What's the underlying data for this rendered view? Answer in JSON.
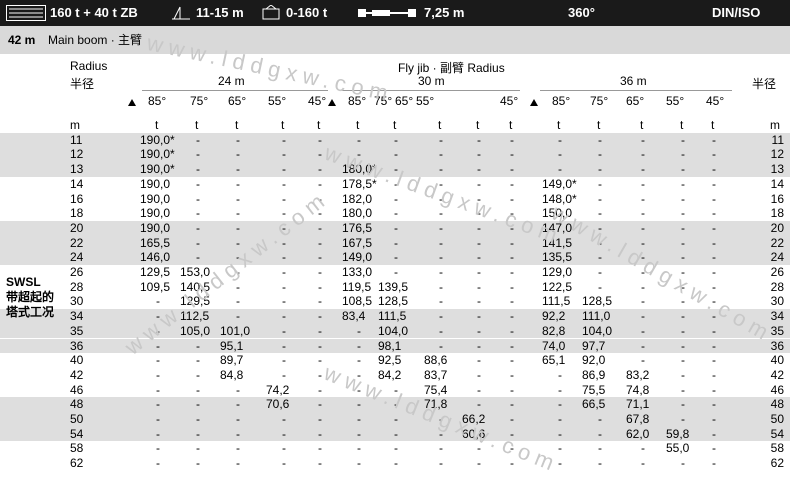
{
  "topbar": {
    "capacity": "160 t + 40 t ZB",
    "counterweight_range": "11-15 m",
    "load_range": "0-160 t",
    "width": "7,25 m",
    "slew": "360°",
    "standard": "DIN/ISO"
  },
  "subbar": {
    "boom_length": "42 m",
    "boom_label": "Main boom · 主臂"
  },
  "header": {
    "radius_label": "Radius",
    "radius_cn": "半径",
    "radius_cn_right": "半径",
    "fly_jib_label": "Fly jib · 副臂 Radius",
    "jib_lengths": [
      "24 m",
      "30 m",
      "36 m"
    ],
    "angles_24": [
      "85°",
      "75°",
      "65°",
      "55°",
      "45°"
    ],
    "angles_30": [
      "85°",
      "75°",
      "65°",
      "55°",
      "45°"
    ],
    "angles_36": [
      "85°",
      "75°",
      "65°",
      "55°",
      "45°"
    ],
    "unit_m": "m",
    "unit_t": "t"
  },
  "side_label": {
    "line1": "SWSL",
    "line2": "带超起的",
    "line3": "塔式工况"
  },
  "watermark": "www.lddgxw.com",
  "rows": [
    {
      "r": "11",
      "v": [
        "190,0*",
        "-",
        "-",
        "-",
        "-",
        "-",
        "-",
        "-",
        "-",
        "-",
        "-",
        "-",
        "-",
        "-",
        "-"
      ]
    },
    {
      "r": "12",
      "v": [
        "190,0*",
        "-",
        "-",
        "-",
        "-",
        "-",
        "-",
        "-",
        "-",
        "-",
        "-",
        "-",
        "-",
        "-",
        "-"
      ]
    },
    {
      "r": "13",
      "v": [
        "190,0*",
        "-",
        "-",
        "-",
        "-",
        "180,0*",
        "-",
        "-",
        "-",
        "-",
        "-",
        "-",
        "-",
        "-",
        "-"
      ]
    },
    {
      "r": "14",
      "v": [
        "190,0",
        "-",
        "-",
        "-",
        "-",
        "178,5*",
        "-",
        "-",
        "-",
        "-",
        "149,0*",
        "-",
        "-",
        "-",
        "-"
      ]
    },
    {
      "r": "16",
      "v": [
        "190,0",
        "-",
        "-",
        "-",
        "-",
        "182,0",
        "-",
        "-",
        "-",
        "-",
        "148,0*",
        "-",
        "-",
        "-",
        "-"
      ]
    },
    {
      "r": "18",
      "v": [
        "190,0",
        "-",
        "-",
        "-",
        "-",
        "180,0",
        "-",
        "-",
        "-",
        "-",
        "150,0",
        "-",
        "-",
        "-",
        "-"
      ]
    },
    {
      "r": "20",
      "v": [
        "190,0",
        "-",
        "-",
        "-",
        "-",
        "176,5",
        "-",
        "-",
        "-",
        "-",
        "147,0",
        "-",
        "-",
        "-",
        "-"
      ]
    },
    {
      "r": "22",
      "v": [
        "165,5",
        "-",
        "-",
        "-",
        "-",
        "167,5",
        "-",
        "-",
        "-",
        "-",
        "141,5",
        "-",
        "-",
        "-",
        "-"
      ]
    },
    {
      "r": "24",
      "v": [
        "146,0",
        "-",
        "-",
        "-",
        "-",
        "149,0",
        "-",
        "-",
        "-",
        "-",
        "135,5",
        "-",
        "-",
        "-",
        "-"
      ]
    },
    {
      "r": "26",
      "v": [
        "129,5",
        "153,0",
        "-",
        "-",
        "-",
        "133,0",
        "-",
        "-",
        "-",
        "-",
        "129,0",
        "-",
        "-",
        "-",
        "-"
      ]
    },
    {
      "r": "28",
      "v": [
        "109,5",
        "140,5",
        "-",
        "-",
        "-",
        "119,5",
        "139,5",
        "-",
        "-",
        "-",
        "122,5",
        "-",
        "-",
        "-",
        "-"
      ]
    },
    {
      "r": "30",
      "v": [
        "-",
        "129,5",
        "-",
        "-",
        "-",
        "108,5",
        "128,5",
        "-",
        "-",
        "-",
        "111,5",
        "128,5",
        "-",
        "-",
        "-"
      ]
    },
    {
      "r": "34",
      "v": [
        "-",
        "112,5",
        "-",
        "-",
        "-",
        "83,4",
        "111,5",
        "-",
        "-",
        "-",
        "92,2",
        "111,0",
        "-",
        "-",
        "-"
      ]
    },
    {
      "r": "35",
      "v": [
        "-",
        "105,0",
        "101,0",
        "-",
        "-",
        "-",
        "104,0",
        "-",
        "-",
        "-",
        "82,8",
        "104,0",
        "-",
        "-",
        "-"
      ]
    },
    {
      "r": "36",
      "v": [
        "-",
        "-",
        "95,1",
        "-",
        "-",
        "-",
        "98,1",
        "-",
        "-",
        "-",
        "74,0",
        "97,7",
        "-",
        "-",
        "-"
      ]
    },
    {
      "r": "40",
      "v": [
        "-",
        "-",
        "89,7",
        "-",
        "-",
        "-",
        "92,5",
        "88,6",
        "-",
        "-",
        "65,1",
        "92,0",
        "-",
        "-",
        "-"
      ]
    },
    {
      "r": "42",
      "v": [
        "-",
        "-",
        "84,8",
        "-",
        "-",
        "-",
        "84,2",
        "83,7",
        "-",
        "-",
        "-",
        "86,9",
        "83,2",
        "-",
        "-"
      ]
    },
    {
      "r": "46",
      "v": [
        "-",
        "-",
        "-",
        "74,2",
        "-",
        "-",
        "-",
        "75,4",
        "-",
        "-",
        "-",
        "75,5",
        "74,8",
        "-",
        "-"
      ]
    },
    {
      "r": "48",
      "v": [
        "-",
        "-",
        "-",
        "70,6",
        "-",
        "-",
        "-",
        "71,8",
        "-",
        "-",
        "-",
        "66,5",
        "71,1",
        "-",
        "-"
      ]
    },
    {
      "r": "50",
      "v": [
        "-",
        "-",
        "-",
        "-",
        "-",
        "-",
        "-",
        "-",
        "66,2",
        "-",
        "-",
        "-",
        "67,8",
        "-",
        "-"
      ]
    },
    {
      "r": "54",
      "v": [
        "-",
        "-",
        "-",
        "-",
        "-",
        "-",
        "-",
        "-",
        "60,6",
        "-",
        "-",
        "-",
        "62,0",
        "59,8",
        "-"
      ]
    },
    {
      "r": "58",
      "v": [
        "-",
        "-",
        "-",
        "-",
        "-",
        "-",
        "-",
        "-",
        "-",
        "-",
        "-",
        "-",
        "-",
        "55,0",
        "-"
      ]
    },
    {
      "r": "62",
      "v": [
        "-",
        "-",
        "-",
        "-",
        "-",
        "-",
        "-",
        "-",
        "-",
        "-",
        "-",
        "-",
        "-",
        "-",
        "-"
      ]
    }
  ]
}
